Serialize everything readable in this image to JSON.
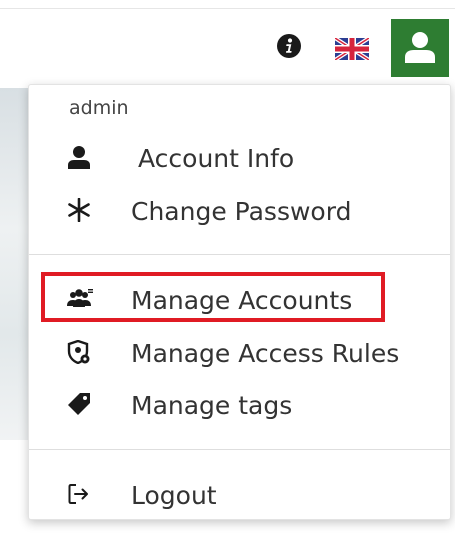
{
  "header": {
    "icons": [
      "info-icon",
      "uk-flag-icon",
      "user-icon"
    ],
    "user_button_color": "#2e7d32"
  },
  "dropdown": {
    "username": "admin",
    "items": [
      {
        "label": "Account Info",
        "icon": "user-icon"
      },
      {
        "label": "Change Password",
        "icon": "asterisk-icon"
      },
      {
        "label": "Manage Accounts",
        "icon": "users-group-icon",
        "highlighted": true
      },
      {
        "label": "Manage Access Rules",
        "icon": "access-rules-icon"
      },
      {
        "label": "Manage tags",
        "icon": "tag-icon"
      },
      {
        "label": "Logout",
        "icon": "logout-icon"
      }
    ],
    "highlight_color": "#e01b24"
  }
}
